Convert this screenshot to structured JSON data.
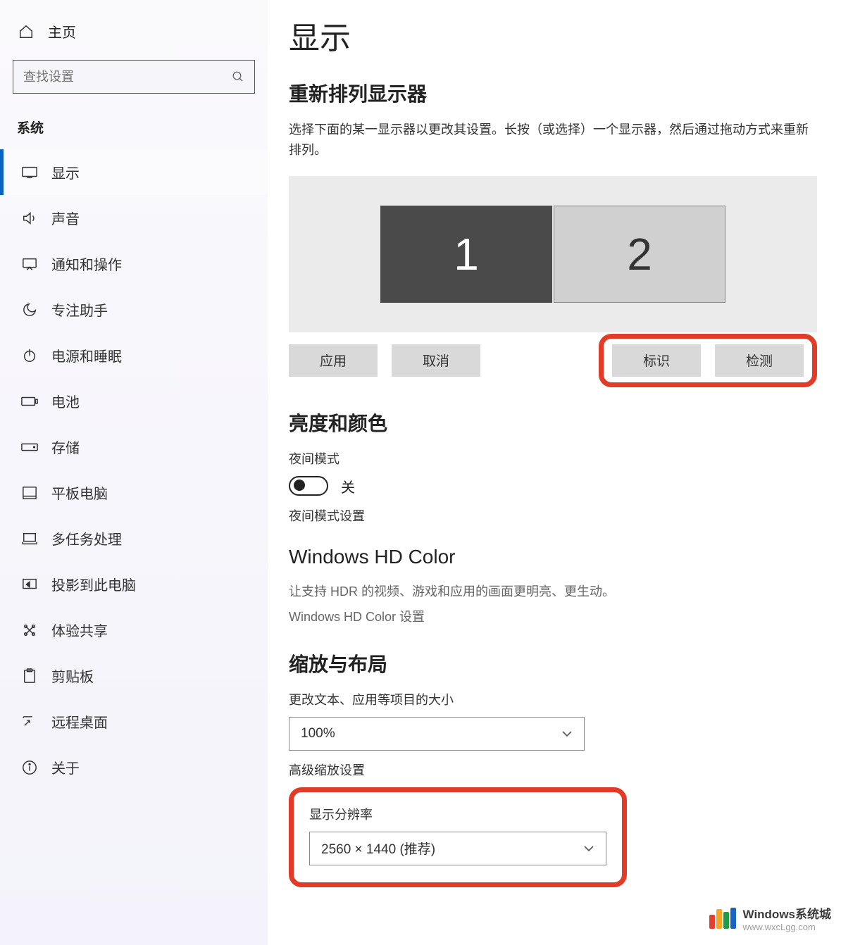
{
  "sidebar": {
    "home_label": "主页",
    "search_placeholder": "查找设置",
    "section_label": "系统",
    "items": [
      {
        "label": "显示"
      },
      {
        "label": "声音"
      },
      {
        "label": "通知和操作"
      },
      {
        "label": "专注助手"
      },
      {
        "label": "电源和睡眠"
      },
      {
        "label": "电池"
      },
      {
        "label": "存储"
      },
      {
        "label": "平板电脑"
      },
      {
        "label": "多任务处理"
      },
      {
        "label": "投影到此电脑"
      },
      {
        "label": "体验共享"
      },
      {
        "label": "剪贴板"
      },
      {
        "label": "远程桌面"
      },
      {
        "label": "关于"
      }
    ]
  },
  "main": {
    "page_title": "显示",
    "rearrange": {
      "title": "重新排列显示器",
      "desc": "选择下面的某一显示器以更改其设置。长按（或选择）一个显示器，然后通过拖动方式来重新排列。",
      "monitor1": "1",
      "monitor2": "2",
      "apply": "应用",
      "cancel": "取消",
      "identify": "标识",
      "detect": "检测"
    },
    "brightness": {
      "title": "亮度和颜色",
      "night_mode_label": "夜间模式",
      "toggle_state": "关",
      "night_settings": "夜间模式设置"
    },
    "hdcolor": {
      "title": "Windows HD Color",
      "desc": "让支持 HDR 的视频、游戏和应用的画面更明亮、更生动。",
      "link": "Windows HD Color 设置"
    },
    "scale": {
      "title": "缩放与布局",
      "size_label": "更改文本、应用等项目的大小",
      "scale_value": "100%",
      "adv_link": "高级缩放设置",
      "res_label": "显示分辨率",
      "res_value": "2560 × 1440 (推荐)"
    }
  },
  "watermark": {
    "line1": "Windows系统城",
    "line2": "www.wxcLgg.com"
  }
}
